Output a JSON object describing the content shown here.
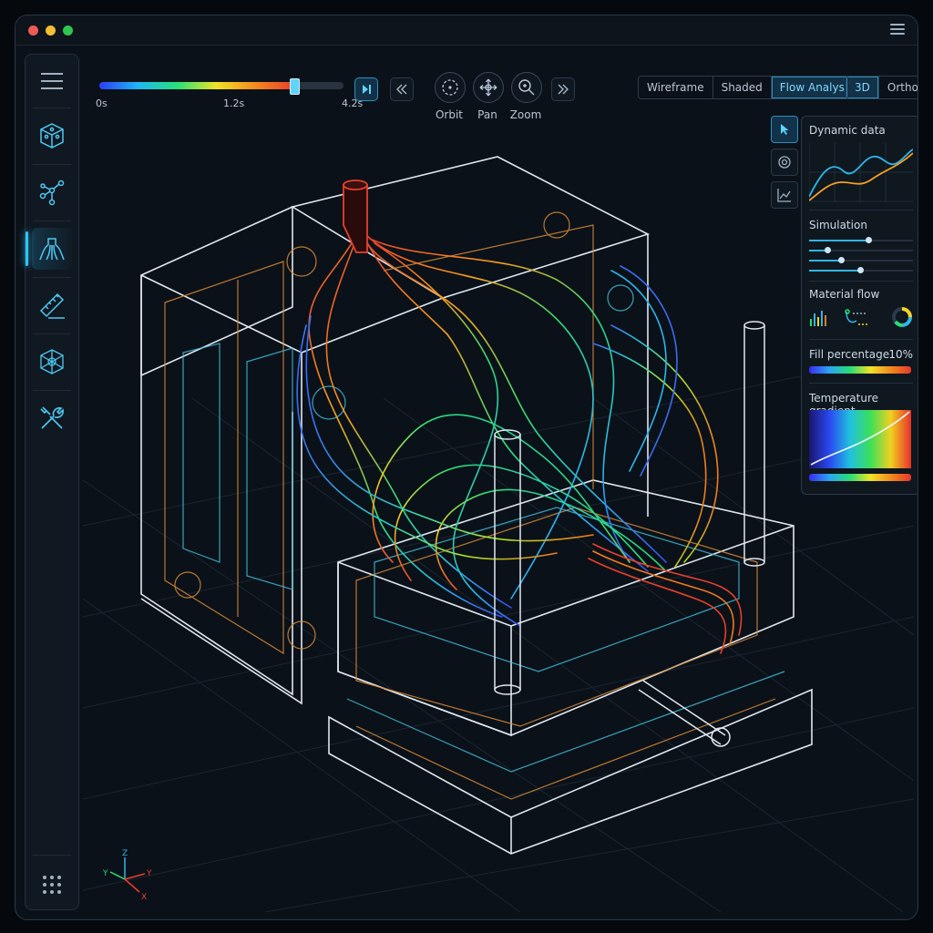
{
  "app": {
    "window_controls": [
      "close",
      "minimize",
      "maximize"
    ],
    "colors": {
      "accent": "#2fc3f5",
      "close": "#f05a56",
      "minimize": "#f4bd34",
      "maximize": "#2ec64f"
    }
  },
  "sidebar": {
    "items": [
      {
        "icon": "menu-icon"
      },
      {
        "icon": "cube-icon"
      },
      {
        "icon": "node-graph-icon"
      },
      {
        "icon": "injection-flow-icon",
        "active": true
      },
      {
        "icon": "ruler-icon"
      },
      {
        "icon": "mesh-icon"
      },
      {
        "icon": "tools-icon"
      },
      {
        "icon": "grid-dots-icon"
      }
    ]
  },
  "timeline": {
    "start_label": "0s",
    "mid_label": "1.2s",
    "end_label": "4.2s",
    "progress": 0.8
  },
  "playback": {
    "play_icon": "play-step-icon",
    "prev_icon": "chevron-left-double-icon",
    "next_icon": "chevron-right-double-icon"
  },
  "tools": [
    {
      "label": "Orbit",
      "icon": "orbit-icon"
    },
    {
      "label": "Pan",
      "icon": "pan-icon"
    },
    {
      "label": "Zoom",
      "icon": "zoom-icon"
    }
  ],
  "view_modes": {
    "options": [
      "Wireframe",
      "Shaded",
      "Flow Analysis"
    ],
    "selected": "Flow Analysis"
  },
  "projection": {
    "options": [
      "3D",
      "Ortho"
    ],
    "selected": "3D"
  },
  "panel": {
    "dynamic_title": "Dynamic data",
    "simulation_title": "Simulation",
    "simulation_sliders": [
      0.58,
      0.18,
      0.32,
      0.5
    ],
    "material_title": "Material flow",
    "fill_title": "Fill percentage",
    "fill_value": "10%",
    "temp_title": "Temperature gradient"
  },
  "axes": {
    "z": "Z",
    "y_left": "Y",
    "y_right": "Y",
    "x": "X"
  }
}
